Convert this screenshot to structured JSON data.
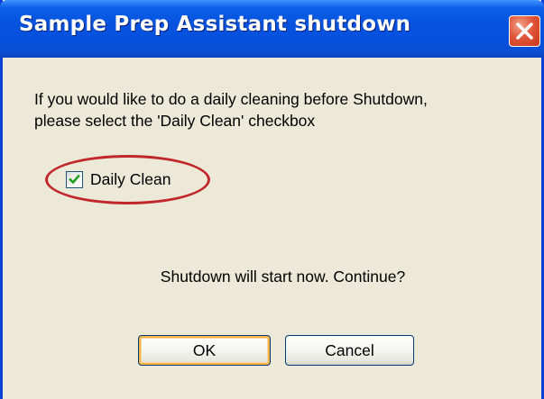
{
  "dialog": {
    "title": "Sample Prep Assistant shutdown",
    "message_line1": "If you would like to do a daily cleaning before Shutdown,",
    "message_line2": "please select the 'Daily Clean' checkbox",
    "checkbox_label": "Daily Clean",
    "checkbox_checked": true,
    "confirm_text": "Shutdown will start now. Continue?",
    "ok_label": "OK",
    "cancel_label": "Cancel"
  },
  "colors": {
    "titlebar": "#0753df",
    "window_bg": "#ece9d8",
    "close_button": "#e0563a",
    "highlight_ellipse": "#c0282c",
    "checkmark": "#21a121"
  },
  "icons": {
    "close": "close-icon",
    "checkmark": "checkmark-icon"
  }
}
